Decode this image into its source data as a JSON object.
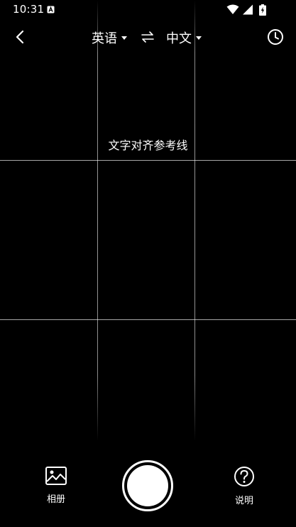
{
  "status_bar": {
    "time": "10:31",
    "icons": [
      "notification-a-icon",
      "wifi-icon",
      "cellular-signal-icon",
      "battery-charging-icon"
    ]
  },
  "top_bar": {
    "back_icon": "chevron-left-icon",
    "source_language": "英语",
    "target_language": "中文",
    "swap_icon": "swap-arrows-icon",
    "history_icon": "clock-icon"
  },
  "viewfinder": {
    "guide_label": "文字对齐参考线"
  },
  "bottom_bar": {
    "album_label": "相册",
    "album_icon": "image-icon",
    "help_label": "说明",
    "help_icon": "question-circle-icon",
    "shutter_icon": "shutter-button"
  },
  "colors": {
    "background": "#000000",
    "foreground": "#ffffff"
  }
}
